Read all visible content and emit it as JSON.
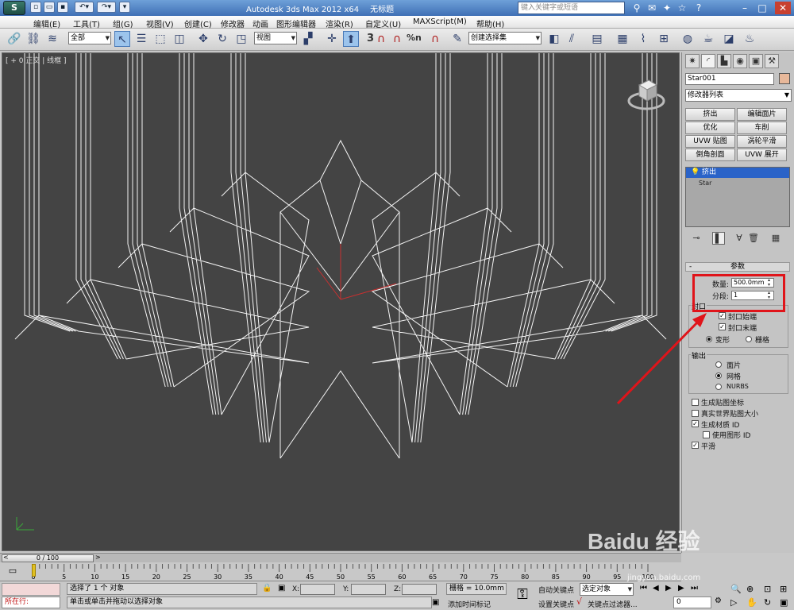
{
  "titlebar": {
    "app_title": "Autodesk 3ds Max  2012 x64",
    "doc_title": "无标题",
    "search_placeholder": "键入关键字或短语"
  },
  "menus": [
    "编辑(E)",
    "工具(T)",
    "组(G)",
    "视图(V)",
    "创建(C)",
    "修改器",
    "动画",
    "图形编辑器",
    "渲染(R)",
    "自定义(U)",
    "MAXScript(M)",
    "帮助(H)"
  ],
  "toolbar": {
    "selection_filter": "全部",
    "reference_coord": "视图",
    "snap_num": "3",
    "percent": "%n",
    "named_selection": "创建选择集"
  },
  "viewport": {
    "label": "[ + 0 正交 | 线框 ]"
  },
  "panel": {
    "object_name": "Star001",
    "object_color": "#e8b89a",
    "modifier_list": "修改器列表",
    "mod_buttons": [
      "挤出",
      "编辑面片",
      "优化",
      "车削",
      "UVW 贴图",
      "涡轮平滑",
      "倒角剖面",
      "UVW 展开"
    ],
    "stack_selected": "挤出",
    "stack_base": "Star",
    "params_title": "参数",
    "amount_label": "数量:",
    "amount_value": "500.0mm",
    "segments_label": "分段:",
    "segments_value": "1",
    "cap_title": "封口",
    "cap_start": "封口始端",
    "cap_end": "封口末端",
    "morph": "变形",
    "grid": "栅格",
    "output_title": "输出",
    "patch": "面片",
    "mesh": "网格",
    "nurbs": "NURBS",
    "gen_map": "生成贴图坐标",
    "real_world": "真实世界贴图大小",
    "gen_matid": "生成材质 ID",
    "use_shape_id": "使用图形 ID",
    "smooth": "平滑"
  },
  "timeline": {
    "frame": "0 / 100",
    "ticks": [
      "0",
      "5",
      "10",
      "15",
      "20",
      "25",
      "30",
      "35",
      "40",
      "45",
      "50",
      "55",
      "60",
      "65",
      "70",
      "75",
      "80",
      "85",
      "90",
      "95",
      "100"
    ]
  },
  "status": {
    "mini_listener": "所在行:",
    "selection_info": "选择了 1 个 对象",
    "prompt": "单击或单击并拖动以选择对象",
    "x_label": "X:",
    "y_label": "Y:",
    "z_label": "Z:",
    "grid_info": "栅格 = 10.0mm",
    "add_tag": "添加时间标记",
    "auto_key": "自动关键点",
    "set_key": "设置关键点",
    "selected_set": "选定对象",
    "key_filters": "关键点过滤器...",
    "frame_field": "0"
  },
  "watermark": "Baidu 经验",
  "watermark_url": "jingyan.baidu.com"
}
